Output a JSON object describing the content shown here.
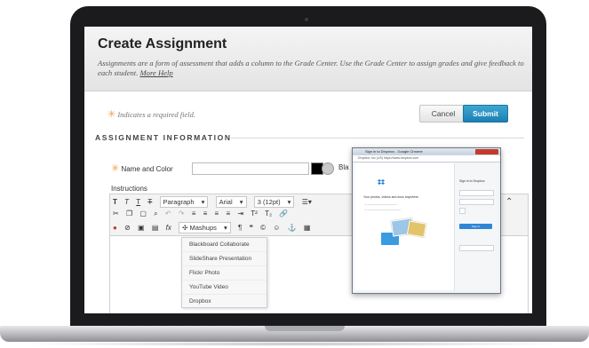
{
  "header": {
    "title": "Create Assignment",
    "description": "Assignments are a form of assessment that adds a column to the Grade Center. Use the Grade Center to assign grades and give feedback to each student.",
    "more_help": "More Help"
  },
  "actions": {
    "required_note": "Indicates a required field.",
    "cancel": "Cancel",
    "submit": "Submit"
  },
  "section": {
    "title": "ASSIGNMENT INFORMATION"
  },
  "form": {
    "name_color_label": "Name and Color",
    "name_value": "",
    "color_text": "Bla",
    "instructions_label": "Instructions"
  },
  "toolbar": {
    "paragraph": "Paragraph",
    "font": "Arial",
    "size": "3 (12pt)",
    "mashups": "Mashups"
  },
  "mashups_menu": [
    "Blackboard Collaborate",
    "SlideShare Presentation",
    "Flickr Photo",
    "YouTube Video",
    "Dropbox"
  ],
  "popup": {
    "window_title": "Sign in to Dropbox - Google Chrome",
    "url": "Dropbox, Inc (US)   https://www.dropbox.com",
    "tagline": "Your photos, videos and docs anywhere",
    "sign_in": "Sign in to Dropbox",
    "sign_in_button": "Sign in"
  },
  "colors": {
    "submit": "#2a93c6",
    "required_star": "#f0a24b",
    "bezel": "#1b1b1d"
  }
}
